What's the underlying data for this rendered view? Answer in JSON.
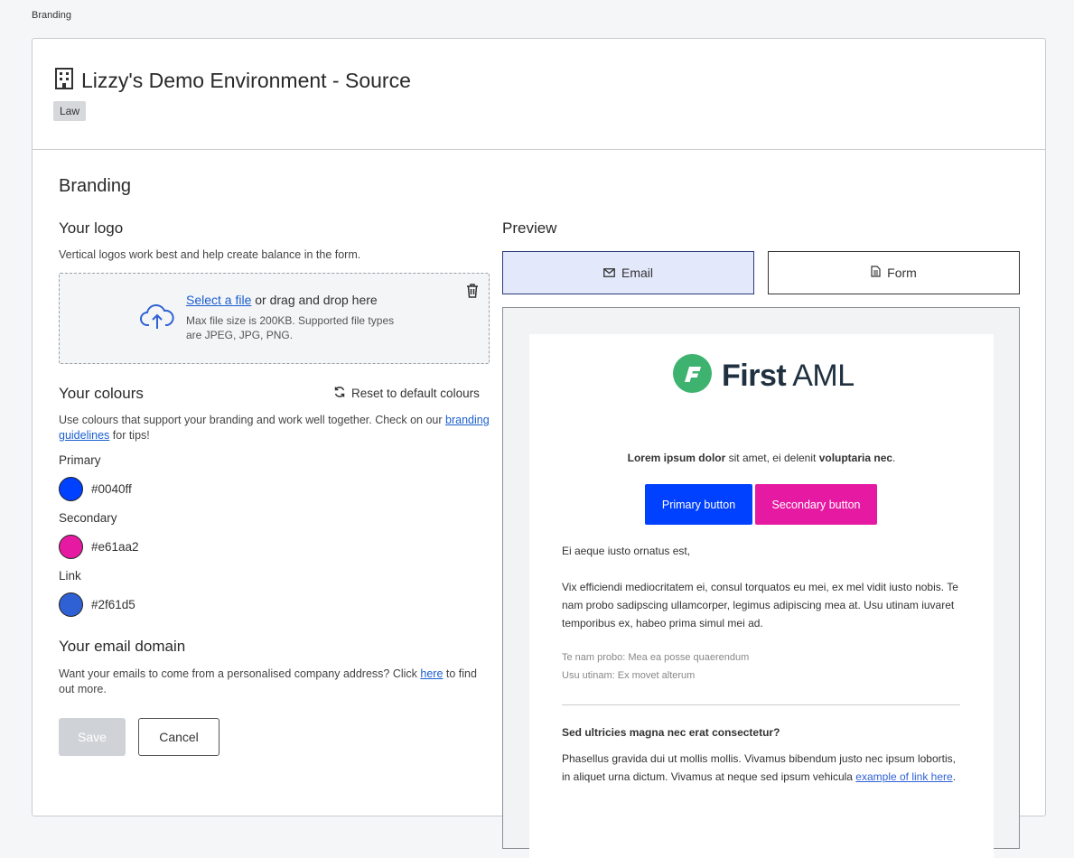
{
  "breadcrumb": "Branding",
  "org": {
    "title": "Lizzy's Demo Environment - Source",
    "tag": "Law"
  },
  "section_title": "Branding",
  "logo": {
    "heading": "Your logo",
    "desc": "Vertical logos work best and help create balance in the form.",
    "select_link": "Select a file",
    "drag_text": " or drag and drop here",
    "hint": "Max file size is 200KB. Supported file types are JPEG, JPG, PNG."
  },
  "colours": {
    "heading": "Your colours",
    "reset": "Reset to default colours",
    "desc_before": "Use colours that support your branding and work well together. Check on our ",
    "desc_link": "branding guidelines",
    "desc_after": " for tips!",
    "items": [
      {
        "label": "Primary",
        "value": "#0040ff",
        "color": "#0040ff"
      },
      {
        "label": "Secondary",
        "value": "#e61aa2",
        "color": "#e61aa2"
      },
      {
        "label": "Link",
        "value": "#2f61d5",
        "color": "#2f61d5"
      }
    ]
  },
  "domain": {
    "heading": "Your email domain",
    "desc_before": "Want your emails to come from a personalised company address? Click ",
    "desc_link": "here",
    "desc_after": " to find out more."
  },
  "actions": {
    "save": "Save",
    "cancel": "Cancel"
  },
  "preview": {
    "heading": "Preview",
    "tabs": {
      "email": "Email",
      "form": "Form"
    },
    "logo_bold": "First",
    "logo_light": " AML",
    "lead": {
      "b1": "Lorem ipsum dolor",
      "t1": " sit amet, ei delenit ",
      "b2": "voluptaria nec",
      "t2": "."
    },
    "primary_button": "Primary button",
    "secondary_button": "Secondary button",
    "greeting": "Ei aeque iusto ornatus est,",
    "body": "Vix efficiendi mediocritatem ei, consul torquatos eu mei, ex mel vidit iusto nobis. Te nam probo sadipscing ullamcorper, legimus adipiscing mea at. Usu utinam iuvaret temporibus ex, habeo prima simul mei ad.",
    "meta1": "Te nam probo: Mea ea posse quaerendum",
    "meta2": "Usu utinam: Ex movet alterum",
    "subheading": "Sed ultricies magna nec erat consectetur?",
    "para_before": "Phasellus gravida dui ut mollis mollis. Vivamus bibendum justo nec ipsum lobortis, in aliquet urna dictum. Vivamus at neque sed ipsum vehicula ",
    "para_link": "example of link here",
    "para_after": "."
  },
  "accent": {
    "primary": "#0040ff",
    "secondary": "#e61aa2",
    "link": "#2f61d5",
    "logo_green": "#3eb370"
  }
}
